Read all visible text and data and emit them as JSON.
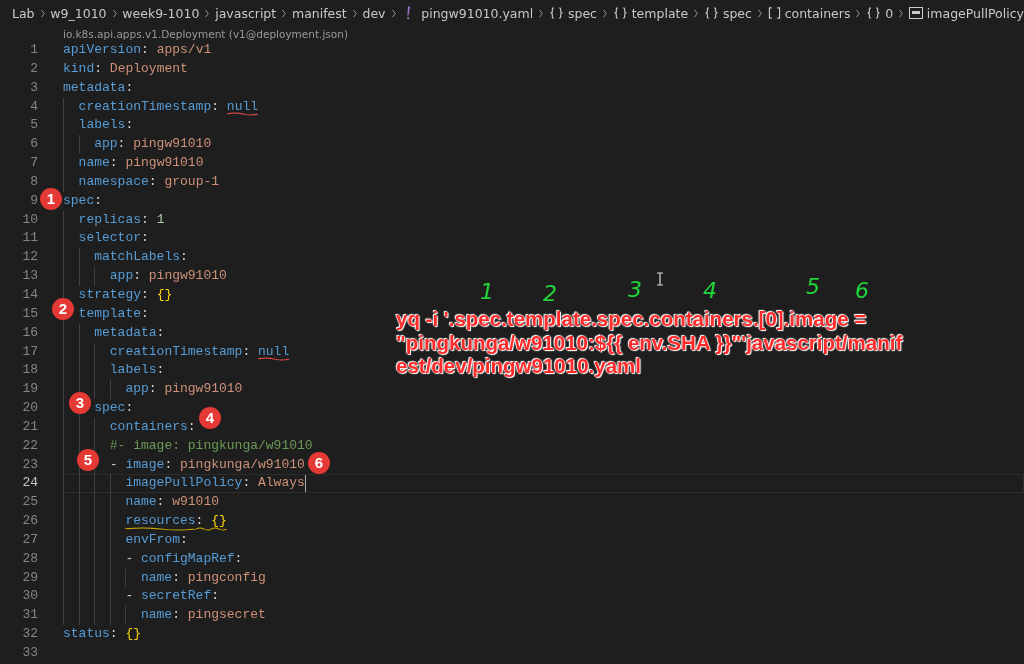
{
  "breadcrumb": [
    {
      "kind": "folder",
      "text": "Lab"
    },
    {
      "kind": "folder",
      "text": "w9_1010"
    },
    {
      "kind": "folder",
      "text": "week9-1010"
    },
    {
      "kind": "folder",
      "text": "javascript"
    },
    {
      "kind": "folder",
      "text": "manifest"
    },
    {
      "kind": "folder",
      "text": "dev"
    },
    {
      "kind": "file",
      "text": "pingw91010.yaml"
    },
    {
      "kind": "object",
      "text": "spec"
    },
    {
      "kind": "object",
      "text": "template"
    },
    {
      "kind": "object",
      "text": "spec"
    },
    {
      "kind": "array",
      "text": "containers"
    },
    {
      "kind": "object",
      "text": "0"
    },
    {
      "kind": "string",
      "text": "imagePullPolicy"
    }
  ],
  "code_lens": "io.k8s.api.apps.v1.Deployment (v1@deployment.json)",
  "lines": [
    {
      "number": "1",
      "current": false,
      "tokens": [
        {
          "kind": "key",
          "text": "apiVersion"
        },
        {
          "kind": "punct",
          "text": ": "
        },
        {
          "kind": "value",
          "text": "apps/v1"
        }
      ]
    },
    {
      "number": "2",
      "current": false,
      "tokens": [
        {
          "kind": "key",
          "text": "kind"
        },
        {
          "kind": "punct",
          "text": ": "
        },
        {
          "kind": "value",
          "text": "Deployment"
        }
      ]
    },
    {
      "number": "3",
      "current": false,
      "tokens": [
        {
          "kind": "key",
          "text": "metadata"
        },
        {
          "kind": "punct",
          "text": ":"
        }
      ]
    },
    {
      "number": "4",
      "current": false,
      "tokens": [
        {
          "kind": "key",
          "text": "  creationTimestamp"
        },
        {
          "kind": "punct",
          "text": ": "
        },
        {
          "kind": "keyword",
          "text": "null",
          "error": true
        }
      ]
    },
    {
      "number": "5",
      "current": false,
      "tokens": [
        {
          "kind": "key",
          "text": "  labels"
        },
        {
          "kind": "punct",
          "text": ":"
        }
      ]
    },
    {
      "number": "6",
      "current": false,
      "tokens": [
        {
          "kind": "key",
          "text": "    app"
        },
        {
          "kind": "punct",
          "text": ": "
        },
        {
          "kind": "value",
          "text": "pingw91010"
        }
      ]
    },
    {
      "number": "7",
      "current": false,
      "tokens": [
        {
          "kind": "key",
          "text": "  name"
        },
        {
          "kind": "punct",
          "text": ": "
        },
        {
          "kind": "value",
          "text": "pingw91010"
        }
      ]
    },
    {
      "number": "8",
      "current": false,
      "tokens": [
        {
          "kind": "key",
          "text": "  namespace"
        },
        {
          "kind": "punct",
          "text": ": "
        },
        {
          "kind": "value",
          "text": "group-1"
        }
      ]
    },
    {
      "number": "9",
      "current": false,
      "tokens": [
        {
          "kind": "key",
          "text": "spec"
        },
        {
          "kind": "punct",
          "text": ":"
        }
      ]
    },
    {
      "number": "10",
      "current": false,
      "tokens": [
        {
          "kind": "key",
          "text": "  replicas"
        },
        {
          "kind": "punct",
          "text": ": "
        },
        {
          "kind": "number",
          "text": "1"
        }
      ]
    },
    {
      "number": "11",
      "current": false,
      "tokens": [
        {
          "kind": "key",
          "text": "  selector"
        },
        {
          "kind": "punct",
          "text": ":"
        }
      ]
    },
    {
      "number": "12",
      "current": false,
      "tokens": [
        {
          "kind": "key",
          "text": "    matchLabels"
        },
        {
          "kind": "punct",
          "text": ":"
        }
      ]
    },
    {
      "number": "13",
      "current": false,
      "tokens": [
        {
          "kind": "key",
          "text": "      app"
        },
        {
          "kind": "punct",
          "text": ": "
        },
        {
          "kind": "value",
          "text": "pingw91010"
        }
      ]
    },
    {
      "number": "14",
      "current": false,
      "tokens": [
        {
          "kind": "key",
          "text": "  strategy"
        },
        {
          "kind": "punct",
          "text": ": "
        },
        {
          "kind": "brace",
          "text": "{}"
        }
      ]
    },
    {
      "number": "15",
      "current": false,
      "tokens": [
        {
          "kind": "key",
          "text": "  template"
        },
        {
          "kind": "punct",
          "text": ":"
        }
      ]
    },
    {
      "number": "16",
      "current": false,
      "tokens": [
        {
          "kind": "key",
          "text": "    metadata"
        },
        {
          "kind": "punct",
          "text": ":"
        }
      ]
    },
    {
      "number": "17",
      "current": false,
      "tokens": [
        {
          "kind": "key",
          "text": "      creationTimestamp"
        },
        {
          "kind": "punct",
          "text": ": "
        },
        {
          "kind": "keyword",
          "text": "null",
          "error": true
        }
      ]
    },
    {
      "number": "18",
      "current": false,
      "tokens": [
        {
          "kind": "key",
          "text": "      labels"
        },
        {
          "kind": "punct",
          "text": ":"
        }
      ]
    },
    {
      "number": "19",
      "current": false,
      "tokens": [
        {
          "kind": "key",
          "text": "        app"
        },
        {
          "kind": "punct",
          "text": ": "
        },
        {
          "kind": "value",
          "text": "pingw91010"
        }
      ]
    },
    {
      "number": "20",
      "current": false,
      "tokens": [
        {
          "kind": "key",
          "text": "    spec"
        },
        {
          "kind": "punct",
          "text": ":"
        }
      ]
    },
    {
      "number": "21",
      "current": false,
      "tokens": [
        {
          "kind": "key",
          "text": "      containers"
        },
        {
          "kind": "punct",
          "text": ":"
        }
      ]
    },
    {
      "number": "22",
      "current": false,
      "tokens": [
        {
          "kind": "comment",
          "text": "      #- image: pingkunga/w91010"
        }
      ]
    },
    {
      "number": "23",
      "current": false,
      "tokens": [
        {
          "kind": "punct",
          "text": "      - "
        },
        {
          "kind": "key",
          "text": "image"
        },
        {
          "kind": "punct",
          "text": ": "
        },
        {
          "kind": "value",
          "text": "pingkunga/w91010"
        }
      ]
    },
    {
      "number": "24",
      "current": true,
      "tokens": [
        {
          "kind": "key",
          "text": "        imagePullPolicy"
        },
        {
          "kind": "punct",
          "text": ": "
        },
        {
          "kind": "value",
          "text": "Always"
        }
      ]
    },
    {
      "number": "25",
      "current": false,
      "tokens": [
        {
          "kind": "key",
          "text": "        name"
        },
        {
          "kind": "punct",
          "text": ": "
        },
        {
          "kind": "value",
          "text": "w91010"
        }
      ]
    },
    {
      "number": "26",
      "current": false,
      "tokens": [
        {
          "kind": "key",
          "text": "        resources",
          "warning": true
        },
        {
          "kind": "punct",
          "text": ": ",
          "warning": true
        },
        {
          "kind": "brace",
          "text": "{}",
          "warning": true
        }
      ]
    },
    {
      "number": "27",
      "current": false,
      "tokens": [
        {
          "kind": "key",
          "text": "        envFrom"
        },
        {
          "kind": "punct",
          "text": ":"
        }
      ]
    },
    {
      "number": "28",
      "current": false,
      "tokens": [
        {
          "kind": "punct",
          "text": "        - "
        },
        {
          "kind": "key",
          "text": "configMapRef"
        },
        {
          "kind": "punct",
          "text": ":"
        }
      ]
    },
    {
      "number": "29",
      "current": false,
      "tokens": [
        {
          "kind": "key",
          "text": "          name"
        },
        {
          "kind": "punct",
          "text": ": "
        },
        {
          "kind": "value",
          "text": "pingconfig"
        }
      ]
    },
    {
      "number": "30",
      "current": false,
      "tokens": [
        {
          "kind": "punct",
          "text": "        - "
        },
        {
          "kind": "key",
          "text": "secretRef"
        },
        {
          "kind": "punct",
          "text": ":"
        }
      ]
    },
    {
      "number": "31",
      "current": false,
      "tokens": [
        {
          "kind": "key",
          "text": "          name"
        },
        {
          "kind": "punct",
          "text": ": "
        },
        {
          "kind": "value",
          "text": "pingsecret"
        }
      ]
    },
    {
      "number": "32",
      "current": false,
      "tokens": [
        {
          "kind": "key",
          "text": "status"
        },
        {
          "kind": "punct",
          "text": ": "
        },
        {
          "kind": "brace",
          "text": "{}"
        }
      ]
    },
    {
      "number": "33",
      "current": false
    }
  ],
  "badges": [
    "1",
    "2",
    "3",
    "4",
    "5",
    "6"
  ],
  "handwritten_numbers": [
    "1",
    "2",
    "3",
    "4",
    "5",
    "6"
  ],
  "note": [
    "yq -i '.spec.template.spec.containers.[0].image =",
    "\"pingkunga/w91010:${{ env.SHA }}\"'javascript/manif",
    "est/dev/pingw91010.yaml"
  ]
}
